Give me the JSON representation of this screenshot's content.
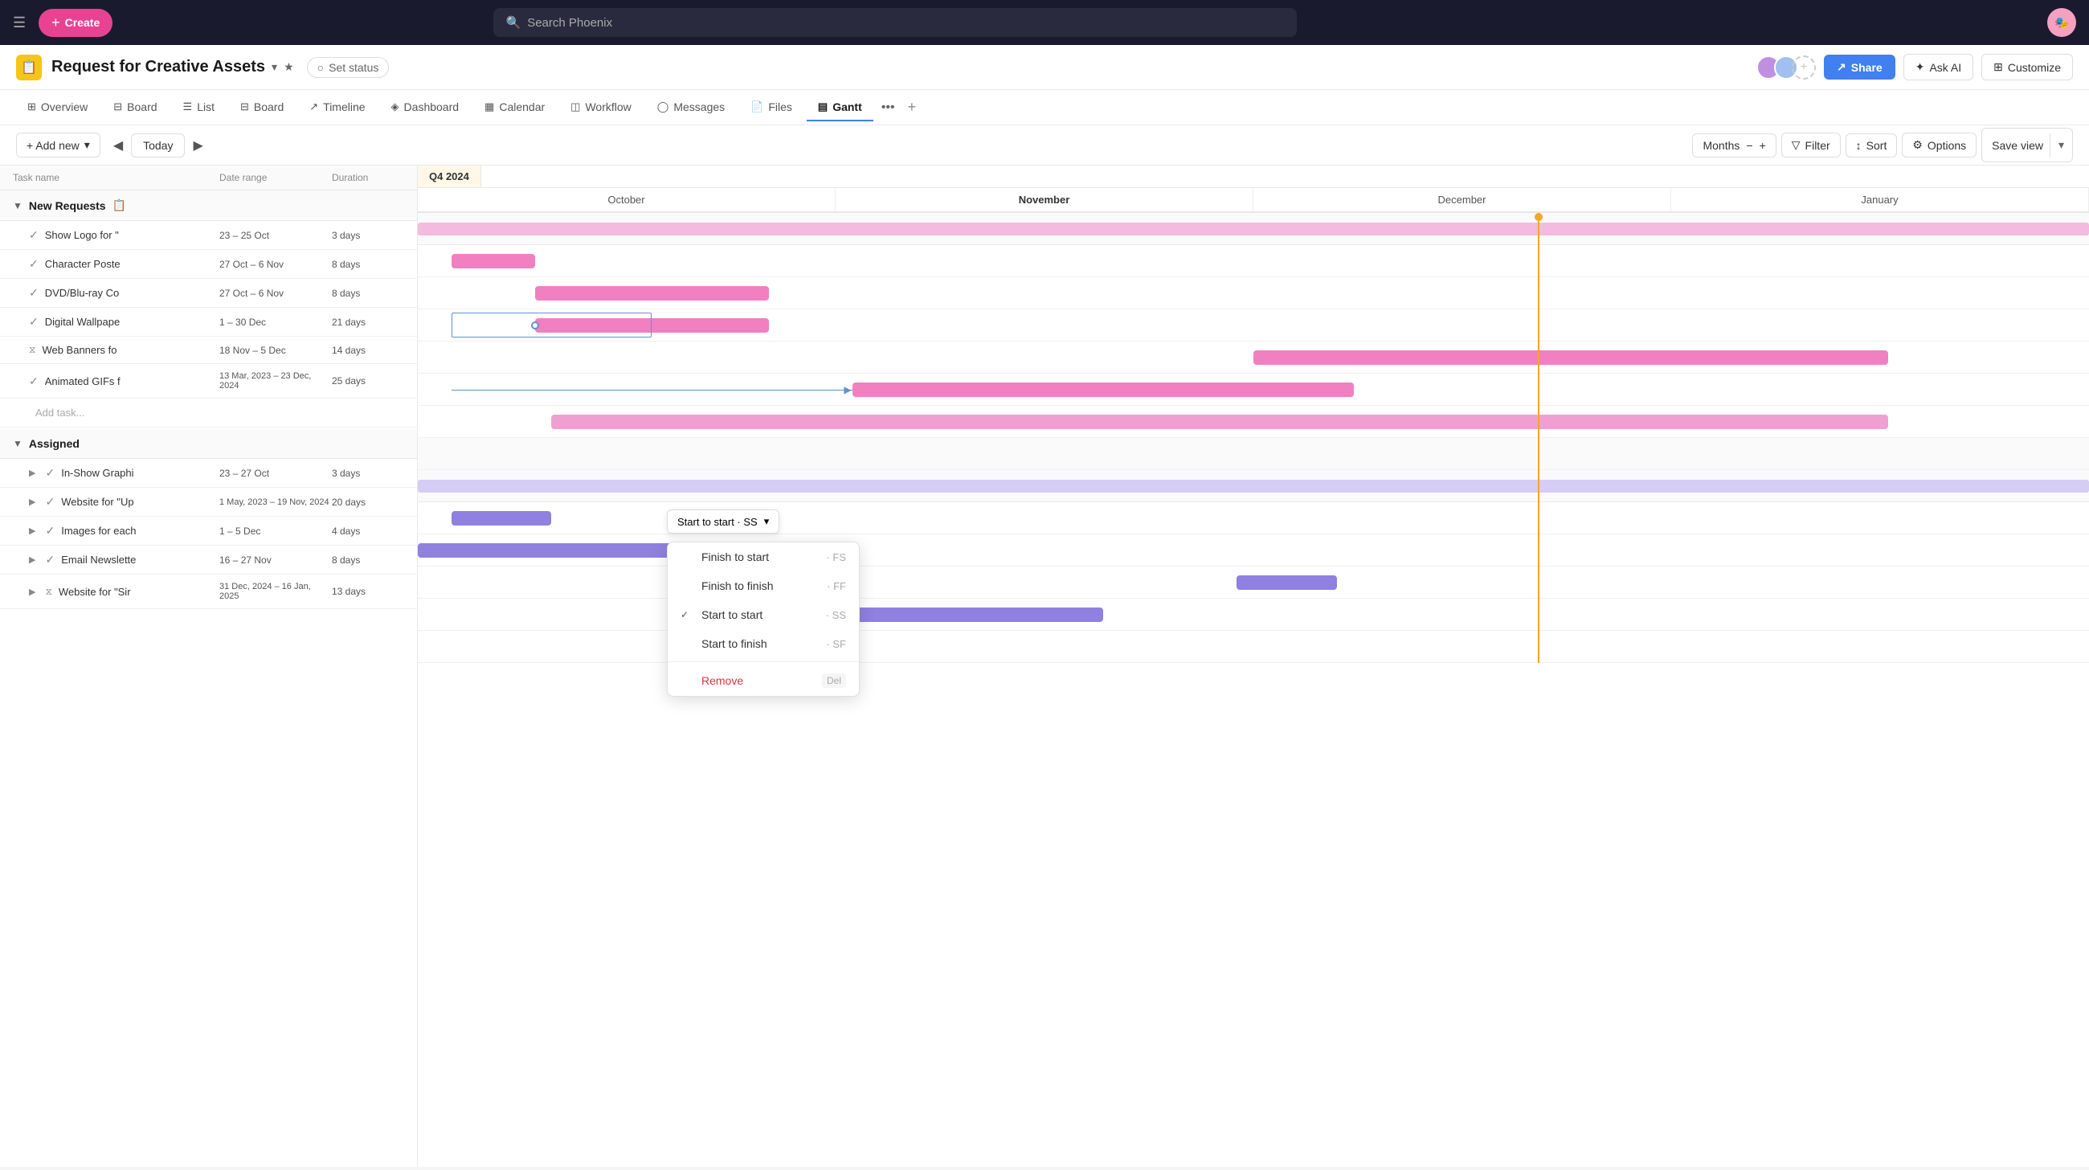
{
  "topnav": {
    "create_label": "Create",
    "search_placeholder": "Search Phoenix"
  },
  "project": {
    "title": "Request for Creative Assets",
    "set_status": "Set status",
    "share": "Share",
    "ask_ai": "Ask AI",
    "customize": "Customize"
  },
  "tabs": [
    {
      "id": "overview",
      "label": "Overview",
      "icon": "⊞"
    },
    {
      "id": "board1",
      "label": "Board",
      "icon": "⊟"
    },
    {
      "id": "list",
      "label": "List",
      "icon": "☰"
    },
    {
      "id": "board2",
      "label": "Board",
      "icon": "⊟"
    },
    {
      "id": "timeline",
      "label": "Timeline",
      "icon": "↗"
    },
    {
      "id": "dashboard",
      "label": "Dashboard",
      "icon": "◈"
    },
    {
      "id": "calendar",
      "label": "Calendar",
      "icon": "▦"
    },
    {
      "id": "workflow",
      "label": "Workflow",
      "icon": "◫"
    },
    {
      "id": "messages",
      "label": "Messages",
      "icon": "◯"
    },
    {
      "id": "files",
      "label": "Files",
      "icon": "📄"
    },
    {
      "id": "gantt",
      "label": "Gantt",
      "icon": "▤",
      "active": true
    }
  ],
  "toolbar": {
    "add_new": "+ Add new",
    "today": "Today",
    "months": "Months",
    "filter": "Filter",
    "sort": "Sort",
    "options": "Options",
    "save_view": "Save view"
  },
  "task_columns": {
    "name": "Task name",
    "date_range": "Date range",
    "duration": "Duration"
  },
  "groups": [
    {
      "id": "new-requests",
      "name": "New Requests",
      "expanded": true,
      "tasks": [
        {
          "id": "t1",
          "name": "Show Logo for \"",
          "date": "23 – 25 Oct",
          "duration": "3 days",
          "check": "done"
        },
        {
          "id": "t2",
          "name": "Character Poste",
          "date": "27 Oct – 6 Nov",
          "duration": "8 days",
          "check": "done"
        },
        {
          "id": "t3",
          "name": "DVD/Blu-ray Co",
          "date": "27 Oct – 6 Nov",
          "duration": "8 days",
          "check": "done"
        },
        {
          "id": "t4",
          "name": "Digital Wallpape",
          "date": "1 – 30 Dec",
          "duration": "21 days",
          "check": "done"
        },
        {
          "id": "t5",
          "name": "Web Banners fo",
          "date": "18 Nov – 5 Dec",
          "duration": "14 days",
          "check": "timer"
        },
        {
          "id": "t6",
          "name": "Animated GIFs f",
          "date": "13 Mar, 2023 – 23 Dec, 2024",
          "duration": "25 days",
          "check": "done"
        }
      ]
    },
    {
      "id": "assigned",
      "name": "Assigned",
      "expanded": true,
      "tasks": [
        {
          "id": "t7",
          "name": "In-Show Graphi",
          "date": "23 – 27 Oct",
          "duration": "3 days",
          "check": "done",
          "expandable": true
        },
        {
          "id": "t8",
          "name": "Website for \"Up",
          "date": "1 May, 2023 – 19 Nov, 2024",
          "duration": "20 days",
          "check": "done",
          "expandable": true
        },
        {
          "id": "t9",
          "name": "Images for each",
          "date": "1 – 5 Dec",
          "duration": "4 days",
          "check": "done",
          "expandable": true
        },
        {
          "id": "t10",
          "name": "Email Newslette",
          "date": "16 – 27 Nov",
          "duration": "8 days",
          "check": "done",
          "expandable": true
        },
        {
          "id": "t11",
          "name": "Website for \"Sir",
          "date": "31 Dec, 2024 – 16 Jan, 2025",
          "duration": "13 days",
          "check": "timer",
          "expandable": true
        }
      ]
    }
  ],
  "gantt": {
    "quarter": "Q4 2024",
    "months": [
      "October",
      "November",
      "December",
      "January"
    ],
    "today_marker_pct": 68
  },
  "dropdown": {
    "trigger_label": "Start to start · SS",
    "items": [
      {
        "id": "finish-start",
        "label": "Finish to start",
        "shortcode": "FS",
        "checked": false
      },
      {
        "id": "finish-finish",
        "label": "Finish to finish",
        "shortcode": "FF",
        "checked": false
      },
      {
        "id": "start-start",
        "label": "Start to start",
        "shortcode": "SS",
        "checked": true
      },
      {
        "id": "start-finish",
        "label": "Start to finish",
        "shortcode": "SF",
        "checked": false
      },
      {
        "id": "remove",
        "label": "Remove",
        "shortcut": "Del",
        "red": true
      }
    ]
  },
  "icons": {
    "hamburger": "☰",
    "plus": "+",
    "search": "🔍",
    "chevron_down": "▾",
    "chevron_right": "▶",
    "chevron_left": "◀",
    "star": "★",
    "circle": "○",
    "share": "↗",
    "ai": "✦",
    "customize": "⋮",
    "minus": "−",
    "plus_small": "+",
    "filter": "▽",
    "sort": "↕",
    "options": "⚙"
  }
}
